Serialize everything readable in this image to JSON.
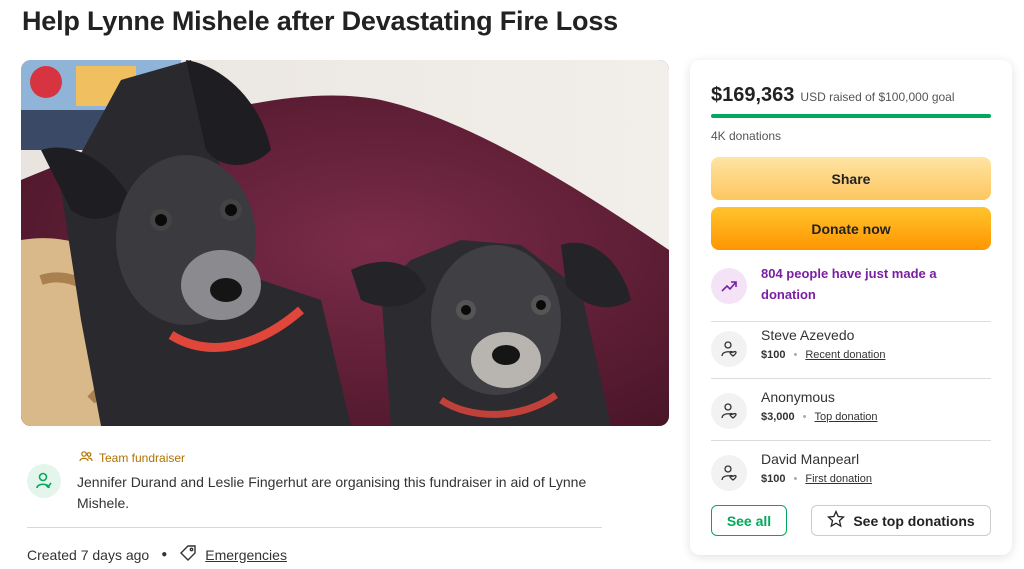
{
  "page": {
    "title": "Help Lynne Mishele after Devastating Fire Loss"
  },
  "hero": {
    "image_icon": "photo-two-dogs"
  },
  "organizer": {
    "tag": "Team fundraiser",
    "text": "Jennifer Durand and Leslie Fingerhut are organising this fundraiser in aid of Lynne Mishele.",
    "created": "Created 7 days ago",
    "category": "Emergencies"
  },
  "card": {
    "amount": "$169,363",
    "goal_text": "USD raised of $100,000 goal",
    "progress_fraction": 1.0,
    "donations_count": "4K donations",
    "share_label": "Share",
    "donate_label": "Donate now",
    "recent_activity": "804 people have just made a donation",
    "donors": [
      {
        "name": "Steve Azevedo",
        "amount": "$100",
        "tag": "Recent donation"
      },
      {
        "name": "Anonymous",
        "amount": "$3,000",
        "tag": "Top donation"
      },
      {
        "name": "David Manpearl",
        "amount": "$100",
        "tag": "First donation"
      }
    ],
    "see_all_label": "See all",
    "see_top_label": "See top donations"
  },
  "colors": {
    "brand_green": "#02a95c",
    "donate_orange": "#ff9500",
    "share_yellow": "#fdc65f",
    "activity_purple": "#7a1fa2"
  }
}
